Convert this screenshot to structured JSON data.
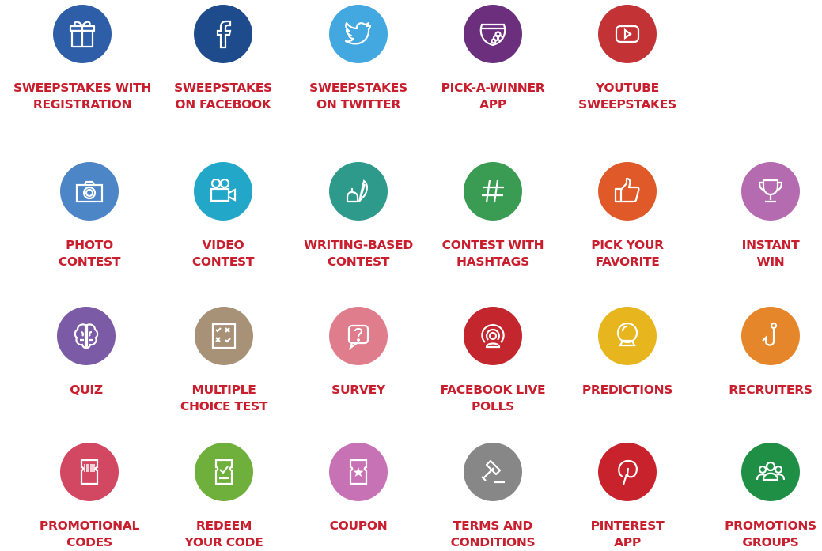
{
  "items": [
    {
      "id": "sweepstakes-with-registration",
      "color": "#2e5ea8",
      "icon": "gift-icon",
      "lines": [
        "SWEEPSTAKES WITH",
        "REGISTRATION"
      ]
    },
    {
      "id": "sweepstakes-on-facebook",
      "color": "#1d4b8c",
      "icon": "facebook-icon",
      "lines": [
        "SWEEPSTAKES",
        "ON FACEBOOK"
      ]
    },
    {
      "id": "sweepstakes-on-twitter",
      "color": "#43a7e0",
      "icon": "twitter-icon",
      "lines": [
        "SWEEPSTAKES",
        "ON TWITTER"
      ]
    },
    {
      "id": "pick-a-winner-app",
      "color": "#6b2f7e",
      "icon": "bowl-icon",
      "lines": [
        "PICK-A-WINNER",
        "APP"
      ]
    },
    {
      "id": "youtube-sweepstakes",
      "color": "#c33234",
      "icon": "youtube-icon",
      "lines": [
        "YOUTUBE",
        "SWEEPSTAKES"
      ]
    },
    {
      "id": "photo-contest",
      "color": "#4d86c6",
      "icon": "camera-icon",
      "lines": [
        "PHOTO",
        "CONTEST"
      ]
    },
    {
      "id": "video-contest",
      "color": "#23a7c9",
      "icon": "video-camera-icon",
      "lines": [
        "VIDEO",
        "CONTEST"
      ]
    },
    {
      "id": "writing-based-contest",
      "color": "#2d9a8c",
      "icon": "quill-ink-icon",
      "lines": [
        "WRITING-BASED",
        "CONTEST"
      ]
    },
    {
      "id": "contest-with-hashtags",
      "color": "#3a9b52",
      "icon": "hashtag-icon",
      "lines": [
        "CONTEST WITH",
        "HASHTAGS"
      ]
    },
    {
      "id": "pick-your-favorite",
      "color": "#df5a28",
      "icon": "thumbs-up-icon",
      "lines": [
        "PICK YOUR",
        "FAVORITE"
      ]
    },
    {
      "id": "instant-win",
      "color": "#b46bb0",
      "icon": "trophy-icon",
      "lines": [
        "INSTANT",
        "WIN"
      ]
    },
    {
      "id": "quiz",
      "color": "#7b5aa6",
      "icon": "brain-icon",
      "lines": [
        "QUIZ"
      ]
    },
    {
      "id": "multiple-choice-test",
      "color": "#a89277",
      "icon": "checklist-icon",
      "lines": [
        "MULTIPLE",
        "CHOICE TEST"
      ]
    },
    {
      "id": "survey",
      "color": "#e07d8c",
      "icon": "question-bubble-icon",
      "lines": [
        "SURVEY"
      ]
    },
    {
      "id": "facebook-live-polls",
      "color": "#c4262e",
      "icon": "live-broadcast-icon",
      "lines": [
        "FACEBOOK LIVE",
        "POLLS"
      ]
    },
    {
      "id": "predictions",
      "color": "#e7b51e",
      "icon": "crystal-ball-icon",
      "lines": [
        "PREDICTIONS"
      ]
    },
    {
      "id": "recruiters",
      "color": "#e6862b",
      "icon": "hook-icon",
      "lines": [
        "RECRUITERS"
      ]
    },
    {
      "id": "promotional-codes",
      "color": "#d24761",
      "icon": "barcode-ticket-icon",
      "lines": [
        "PROMOTIONAL",
        "CODES"
      ]
    },
    {
      "id": "redeem-your-code",
      "color": "#6faf3c",
      "icon": "check-ticket-icon",
      "lines": [
        "REDEEM",
        "YOUR CODE"
      ]
    },
    {
      "id": "coupon",
      "color": "#c772b4",
      "icon": "star-ticket-icon",
      "lines": [
        "COUPON"
      ]
    },
    {
      "id": "terms-and-conditions",
      "color": "#878787",
      "icon": "gavel-icon",
      "lines": [
        "TERMS AND",
        "CONDITIONS"
      ]
    },
    {
      "id": "pinterest-app",
      "color": "#c8232c",
      "icon": "pinterest-icon",
      "lines": [
        "PINTEREST",
        "APP"
      ]
    },
    {
      "id": "promotions-groups",
      "color": "#1f8f46",
      "icon": "group-icon",
      "lines": [
        "PROMOTIONS",
        "GROUPS"
      ]
    }
  ]
}
